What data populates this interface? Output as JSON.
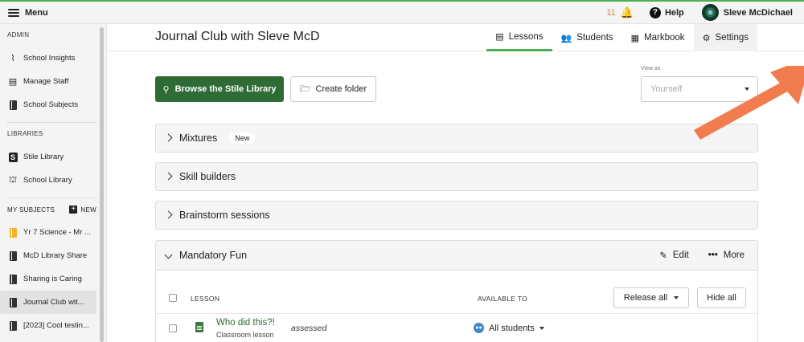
{
  "topbar": {
    "menu_label": "Menu",
    "notification_count": "11",
    "help_label": "Help",
    "user_name": "Sleve McDichael"
  },
  "sidebar": {
    "admin_heading": "ADMIN",
    "admin_items": [
      {
        "label": "School Insights",
        "icon": "pulse-icon"
      },
      {
        "label": "Manage Staff",
        "icon": "staff-icon"
      },
      {
        "label": "School Subjects",
        "icon": "book-icon"
      }
    ],
    "libraries_heading": "LIBRARIES",
    "library_items": [
      {
        "label": "Stile Library",
        "icon": "stile-s-icon"
      },
      {
        "label": "School Library",
        "icon": "school-icon"
      }
    ],
    "my_subjects_heading": "MY SUBJECTS",
    "new_label": "NEW",
    "subjects": [
      {
        "label": "Yr 7 Science - Mr ...",
        "icon": "yellow-book-icon"
      },
      {
        "label": "McD Library Share",
        "icon": "book-icon"
      },
      {
        "label": "Sharing is Caring",
        "icon": "book-icon"
      },
      {
        "label": "Journal Club wit...",
        "icon": "book-icon",
        "active": true
      },
      {
        "label": "[2023] Cool testin...",
        "icon": "book-icon"
      }
    ]
  },
  "header": {
    "title": "Journal Club with Sleve McD",
    "tabs": [
      {
        "label": "Lessons",
        "icon": "lessons-icon",
        "active": true
      },
      {
        "label": "Students",
        "icon": "students-icon"
      },
      {
        "label": "Markbook",
        "icon": "markbook-icon"
      },
      {
        "label": "Settings",
        "icon": "gear-icon"
      }
    ]
  },
  "toolbar": {
    "browse_label": "Browse the Stile Library",
    "create_folder_label": "Create folder",
    "view_as_label": "View as",
    "view_as_value": "Yourself"
  },
  "folders": [
    {
      "name": "Mixtures",
      "badge": "New",
      "expanded": false
    },
    {
      "name": "Skill builders",
      "expanded": false
    },
    {
      "name": "Brainstorm sessions",
      "expanded": false
    },
    {
      "name": "Mandatory Fun",
      "expanded": true,
      "edit_label": "Edit",
      "more_label": "More"
    }
  ],
  "lesson_table": {
    "col_lesson": "LESSON",
    "col_available": "AVAILABLE TO",
    "release_all_label": "Release all",
    "hide_all_label": "Hide all",
    "rows": [
      {
        "title": "Who did this?!",
        "type": "Classroom lesson",
        "status": "assessed",
        "available_to": "All students"
      }
    ]
  },
  "colors": {
    "accent_green": "#2e6b35",
    "tab_underline": "#4caf50",
    "arrow": "#f07c4f",
    "notification": "#e8833a"
  }
}
